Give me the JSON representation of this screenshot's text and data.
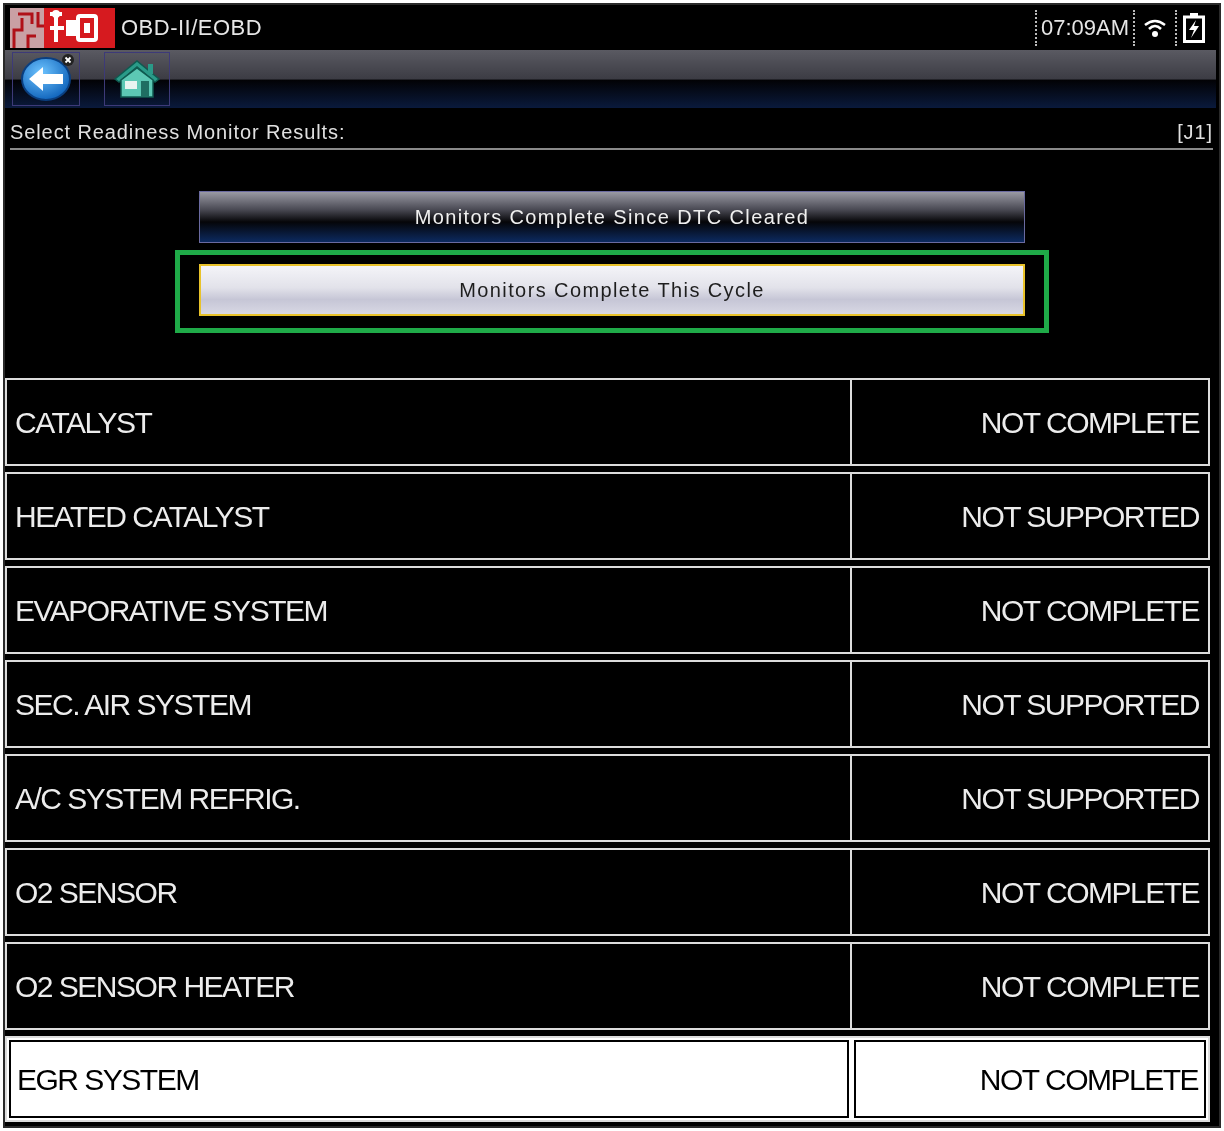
{
  "status_bar": {
    "title": "OBD-II/EOBD",
    "time": "07:09AM"
  },
  "header": {
    "title": "Select Readiness Monitor Results:",
    "tag": "[J1]"
  },
  "options": [
    {
      "label": "Monitors Complete Since DTC Cleared",
      "selected": false,
      "highlighted": false
    },
    {
      "label": "Monitors Complete This Cycle",
      "selected": true,
      "highlighted": true
    }
  ],
  "table": {
    "rows": [
      {
        "monitor": "CATALYST",
        "status": "NOT COMPLETE",
        "selected": false
      },
      {
        "monitor": "HEATED CATALYST",
        "status": "NOT SUPPORTED",
        "selected": false
      },
      {
        "monitor": "EVAPORATIVE SYSTEM",
        "status": "NOT COMPLETE",
        "selected": false
      },
      {
        "monitor": "SEC. AIR SYSTEM",
        "status": "NOT SUPPORTED",
        "selected": false
      },
      {
        "monitor": "A/C SYSTEM REFRIG.",
        "status": "NOT SUPPORTED",
        "selected": false
      },
      {
        "monitor": "O2 SENSOR",
        "status": "NOT COMPLETE",
        "selected": false
      },
      {
        "monitor": "O2 SENSOR HEATER",
        "status": "NOT COMPLETE",
        "selected": false
      },
      {
        "monitor": "EGR SYSTEM",
        "status": "NOT COMPLETE",
        "selected": true
      }
    ]
  }
}
